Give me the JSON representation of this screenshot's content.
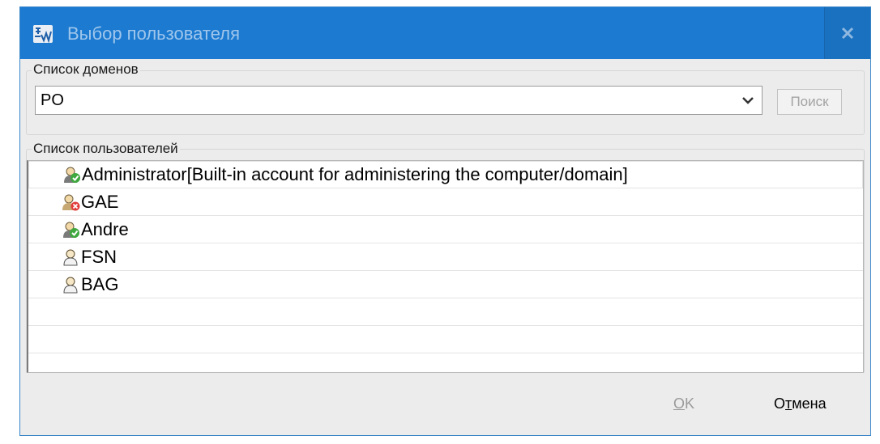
{
  "window": {
    "title": "Выбор пользователя",
    "close_label": "x",
    "accent_color": "#1c7ad0"
  },
  "domains": {
    "group_label": "Список доменов",
    "selected": "PO",
    "search_label": "Поиск"
  },
  "users": {
    "group_label": "Список пользователей",
    "items": [
      {
        "name": "Administrator[Built-in account for administering the computer/domain]",
        "icon": "user-ok-icon",
        "selected": true
      },
      {
        "name": "GAE",
        "icon": "user-disabled-icon",
        "selected": false
      },
      {
        "name": "Andre",
        "icon": "user-ok-icon",
        "selected": false
      },
      {
        "name": "FSN",
        "icon": "user-icon",
        "selected": false
      },
      {
        "name": "BAG",
        "icon": "user-icon",
        "selected": false
      }
    ]
  },
  "footer": {
    "ok_label": "OK",
    "ok_mnemonic": "O",
    "ok_rest": "K",
    "cancel_label": "Отмена",
    "cancel_prefix": "О",
    "cancel_mnemonic": "т",
    "cancel_rest": "мена"
  }
}
